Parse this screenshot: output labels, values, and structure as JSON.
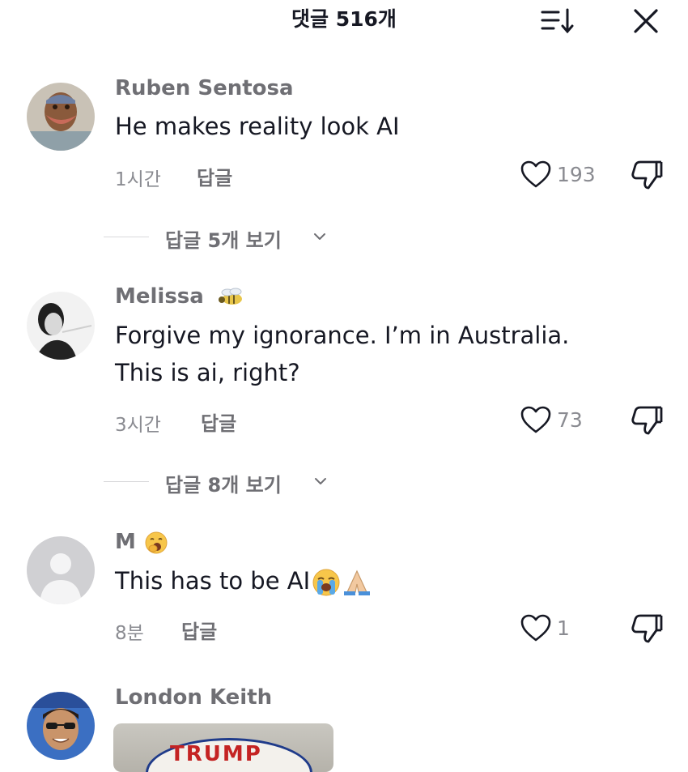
{
  "header": {
    "title": "댓글 516개"
  },
  "comments": [
    {
      "username": "Ruben Sentosa",
      "text_lines": [
        "He makes reality look AI"
      ],
      "time": "1시간",
      "reply_label": "답글",
      "likes": "193",
      "view_replies": "답글 5개 보기"
    },
    {
      "username": "Melissa",
      "text_lines": [
        "Forgive my ignorance. I’m in Australia.",
        "This is ai, right?"
      ],
      "time": "3시간",
      "reply_label": "답글",
      "likes": "73",
      "view_replies": "답글 8개 보기"
    },
    {
      "username": "M",
      "text_lines": [
        "This has to be AI"
      ],
      "time": "8분",
      "reply_label": "답글",
      "likes": "1"
    },
    {
      "username": "London Keith",
      "image_text": "TRUMP"
    }
  ],
  "colors": {
    "text": "#161823",
    "secondary": "#8a8b91",
    "username": "#6f6f74",
    "divider": "#d9d9db"
  },
  "icons": [
    "sort-icon",
    "close-icon",
    "heart-icon",
    "dislike-icon",
    "chevron-down-icon",
    "loudly-crying-face-emoji",
    "folded-hands-emoji",
    "yawning-face-emoji",
    "bee-emoji"
  ]
}
